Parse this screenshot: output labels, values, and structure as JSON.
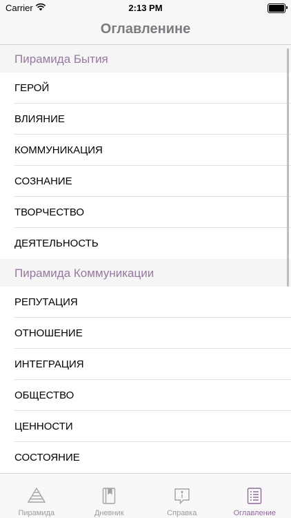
{
  "status_bar": {
    "carrier": "Carrier",
    "time": "2:13 PM"
  },
  "nav": {
    "title": "Оглавленине"
  },
  "sections": [
    {
      "header": "Пирамида Бытия",
      "items": [
        "ГЕРОЙ",
        "ВЛИЯНИЕ",
        "КОММУНИКАЦИЯ",
        "СОЗНАНИЕ",
        "ТВОРЧЕСТВО",
        "ДЕЯТЕЛЬНОСТЬ"
      ]
    },
    {
      "header": "Пирамида Коммуникации",
      "items": [
        "РЕПУТАЦИЯ",
        "ОТНОШЕНИЕ",
        "ИНТЕГРАЦИЯ",
        "ОБЩЕСТВО",
        "ЦЕННОСТИ",
        "СОСТОЯНИЕ"
      ]
    }
  ],
  "tabs": [
    {
      "label": "Пирамида",
      "icon": "pyramid-icon"
    },
    {
      "label": "Дневник",
      "icon": "book-icon"
    },
    {
      "label": "Справка",
      "icon": "info-bubble-icon"
    },
    {
      "label": "Оглавление",
      "icon": "list-icon",
      "active": true
    }
  ],
  "colors": {
    "accent": "#8e6a97",
    "section_header_text": "#97789f",
    "tab_inactive": "#9a9a9a"
  }
}
